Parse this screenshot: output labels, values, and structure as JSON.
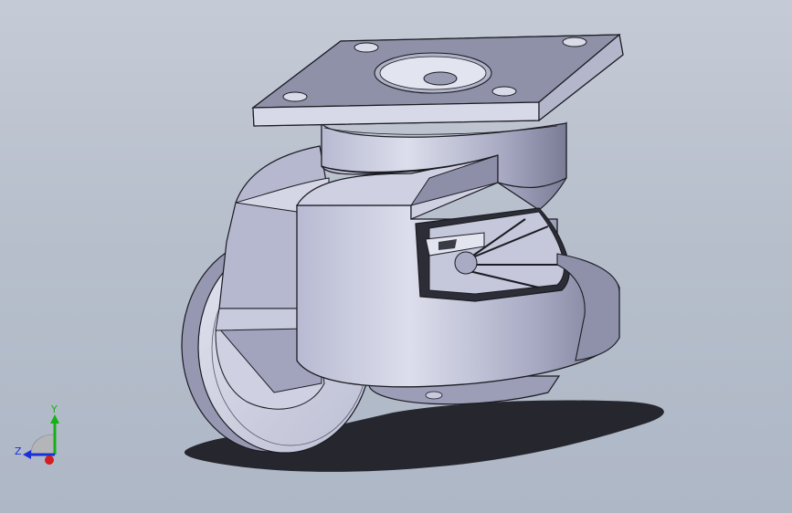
{
  "viewport": {
    "background_top": "#c5cbd6",
    "background_bottom": "#aeb7c6"
  },
  "model": {
    "name_icon": "leveling-caster-3d-model",
    "colors": {
      "metal_light": "#d2d4e4",
      "metal_mid": "#a9abc3",
      "metal_dark": "#6d6f86",
      "edge": "#1b1b22"
    }
  },
  "triad": {
    "x_label": "",
    "y_label": "Y",
    "z_label": "Z",
    "colors": {
      "x": "#d41e1e",
      "y": "#18b018",
      "z": "#1a2fd8"
    }
  }
}
